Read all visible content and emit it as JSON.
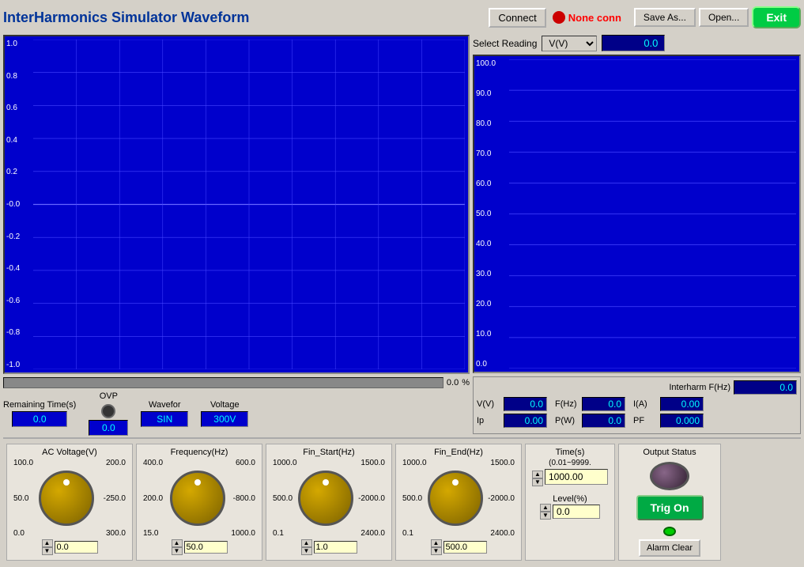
{
  "header": {
    "title": "InterHarmonics Simulator Waveform",
    "connect_label": "Connect",
    "conn_status": "None conn",
    "save_label": "Save As...",
    "open_label": "Open...",
    "exit_label": "Exit"
  },
  "waveform": {
    "y_labels": [
      "1.0",
      "0.8",
      "0.6",
      "0.4",
      "0.2",
      "-0.0",
      "-0.2",
      "-0.4",
      "-0.6",
      "-0.8",
      "-1.0"
    ],
    "progress_value": "0.0",
    "progress_unit": "%"
  },
  "lower_controls": {
    "remaining_time_label": "Remaining Time(s)",
    "remaining_time_value": "0.0",
    "ovp_label": "OVP",
    "ovp_value": "0.0",
    "waveform_label": "Wavefor",
    "waveform_value": "SIN",
    "voltage_label": "Voltage",
    "voltage_value": "300V"
  },
  "right_panel": {
    "select_reading_label": "Select Reading",
    "reading_type": "V(V)",
    "reading_value": "0.0",
    "bar_y_labels": [
      "100.0",
      "90.0",
      "80.0",
      "70.0",
      "60.0",
      "50.0",
      "40.0",
      "30.0",
      "20.0",
      "10.0",
      "0.0"
    ],
    "interharm_label": "Interharm F(Hz)",
    "interharm_value": "0.0",
    "vv_label": "V(V)",
    "vv_value": "0.0",
    "fhz_label": "F(Hz)",
    "fhz_value": "0.0",
    "ia_label": "I(A)",
    "ia_value": "0.00",
    "ip_label": "Ip",
    "ip_value": "0.00",
    "pw_label": "P(W)",
    "pw_value": "0.0",
    "pf_label": "PF",
    "pf_value": "0.000"
  },
  "bottom": {
    "ac_voltage_label": "AC Voltage(V)",
    "ac_range_top_left": "100.0",
    "ac_range_top_right": "200.0",
    "ac_range_mid_left": "50.0",
    "ac_range_mid_right": "-250.0",
    "ac_range_bot_left": "0.0",
    "ac_range_bot_right": "300.0",
    "ac_value": "0.0",
    "freq_label": "Frequency(Hz)",
    "freq_top_left": "400.0",
    "freq_top_right": "600.0",
    "freq_mid_left": "200.0",
    "freq_mid_right": "-800.0",
    "freq_bot_left": "15.0",
    "freq_bot_right": "1000.0",
    "freq_value": "50.0",
    "fin_start_label": "Fin_Start(Hz)",
    "fins_top_left": "1000.0",
    "fins_top_right": "1500.0",
    "fins_mid_left": "500.0",
    "fins_mid_right": "-2000.0",
    "fins_bot_left": "0.1",
    "fins_bot_right": "2400.0",
    "fins_value": "1.0",
    "fin_end_label": "Fin_End(Hz)",
    "fine_top_left": "1000.0",
    "fine_top_right": "1500.0",
    "fine_mid_left": "500.0",
    "fine_mid_right": "-2000.0",
    "fine_bot_left": "0.1",
    "fine_bot_right": "2400.0",
    "fine_value": "500.0",
    "time_label": "Time(s)",
    "time_range": "(0.01~9999.",
    "time_value": "1000.00",
    "level_label": "Level(%)",
    "level_value": "0.0",
    "output_title": "Output Status",
    "trig_label": "Trig On",
    "alarm_clear_label": "Alarm Clear"
  }
}
